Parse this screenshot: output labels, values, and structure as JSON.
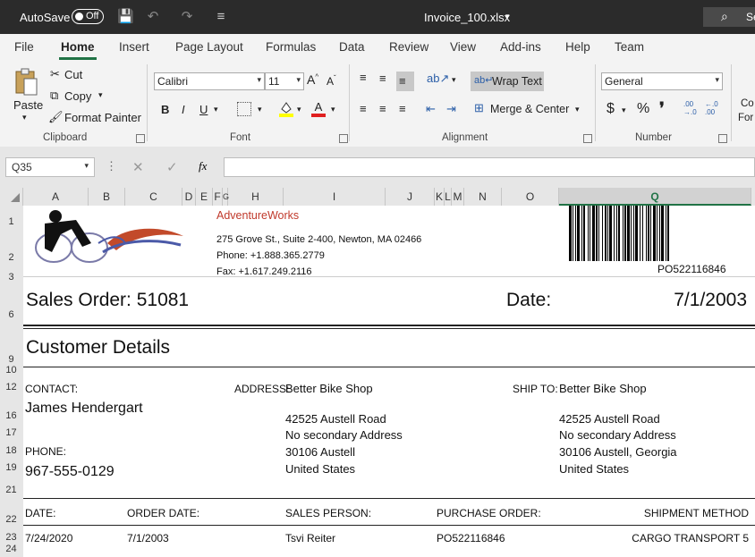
{
  "titlebar": {
    "autosave_label": "AutoSave",
    "autosave_state": "Off",
    "doc_title": "Invoice_100.xlsx",
    "search_placeholder": "Se"
  },
  "tabs": [
    {
      "label": "File"
    },
    {
      "label": "Home"
    },
    {
      "label": "Insert"
    },
    {
      "label": "Page Layout"
    },
    {
      "label": "Formulas"
    },
    {
      "label": "Data"
    },
    {
      "label": "Review"
    },
    {
      "label": "View"
    },
    {
      "label": "Add-ins"
    },
    {
      "label": "Help"
    },
    {
      "label": "Team"
    }
  ],
  "ribbon": {
    "clipboard": {
      "paste": "Paste",
      "cut": "Cut",
      "copy": "Copy",
      "format_painter": "Format Painter",
      "label": "Clipboard"
    },
    "font": {
      "name": "Calibri",
      "size": "11",
      "label": "Font",
      "bold": "B",
      "italic": "I",
      "underline": "U",
      "font_color_glyph": "A"
    },
    "alignment": {
      "wrap": "Wrap Text",
      "merge": "Merge & Center",
      "label": "Alignment"
    },
    "number": {
      "format": "General",
      "label": "Number",
      "currency": "$",
      "percent": "%",
      "comma": "❜",
      "inc_decimal": ".00 →.0",
      "dec_decimal": "←.0 .00"
    },
    "styles_partial": [
      "Co",
      "For"
    ]
  },
  "formula_bar": {
    "name_box": "Q35",
    "fx": "fx",
    "value": ""
  },
  "columns": [
    "A",
    "B",
    "C",
    "D",
    "E",
    "F",
    "G",
    "H",
    "I",
    "J",
    "K",
    "L",
    "M",
    "N",
    "O",
    "Q"
  ],
  "rows": [
    "1",
    "2",
    "3",
    "6",
    "9",
    "10",
    "12",
    "16",
    "17",
    "18",
    "19",
    "21",
    "22",
    "23",
    "24"
  ],
  "sheet": {
    "company": "AdventureWorks",
    "address": "275 Grove St., Suite 2-400, Newton, MA 02466",
    "phone": "Phone: +1.888.365.2779",
    "fax": "Fax: +1.617.249.2116",
    "barcode_text": "PO522116846",
    "sales_order": "Sales Order: 51081",
    "date_label": "Date:",
    "date_value": "7/1/2003",
    "customer_details": "Customer Details",
    "contact_label": "CONTACT:",
    "contact_name": "James Hendergart",
    "phone_label": "PHONE:",
    "phone_value": "967-555-0129",
    "address_label": "ADDRESS:",
    "address_lines": [
      "Better Bike Shop",
      "42525 Austell Road",
      "No secondary Address",
      "30106 Austell",
      "United States"
    ],
    "ship_label": "SHIP TO:",
    "ship_lines": [
      "Better Bike Shop",
      "42525 Austell Road",
      "No secondary Address",
      "30106 Austell, Georgia",
      "United States"
    ],
    "headers": [
      "DATE:",
      "ORDER DATE:",
      "SALES PERSON:",
      "PURCHASE ORDER:",
      "SHIPMENT METHOD"
    ],
    "values": [
      "7/24/2020",
      "7/1/2003",
      "Tsvi Reiter",
      "PO522116846",
      "CARGO TRANSPORT 5"
    ]
  },
  "colors": {
    "accent": "#217346",
    "company": "#c0392b",
    "titlebar": "#2b2b2b"
  }
}
